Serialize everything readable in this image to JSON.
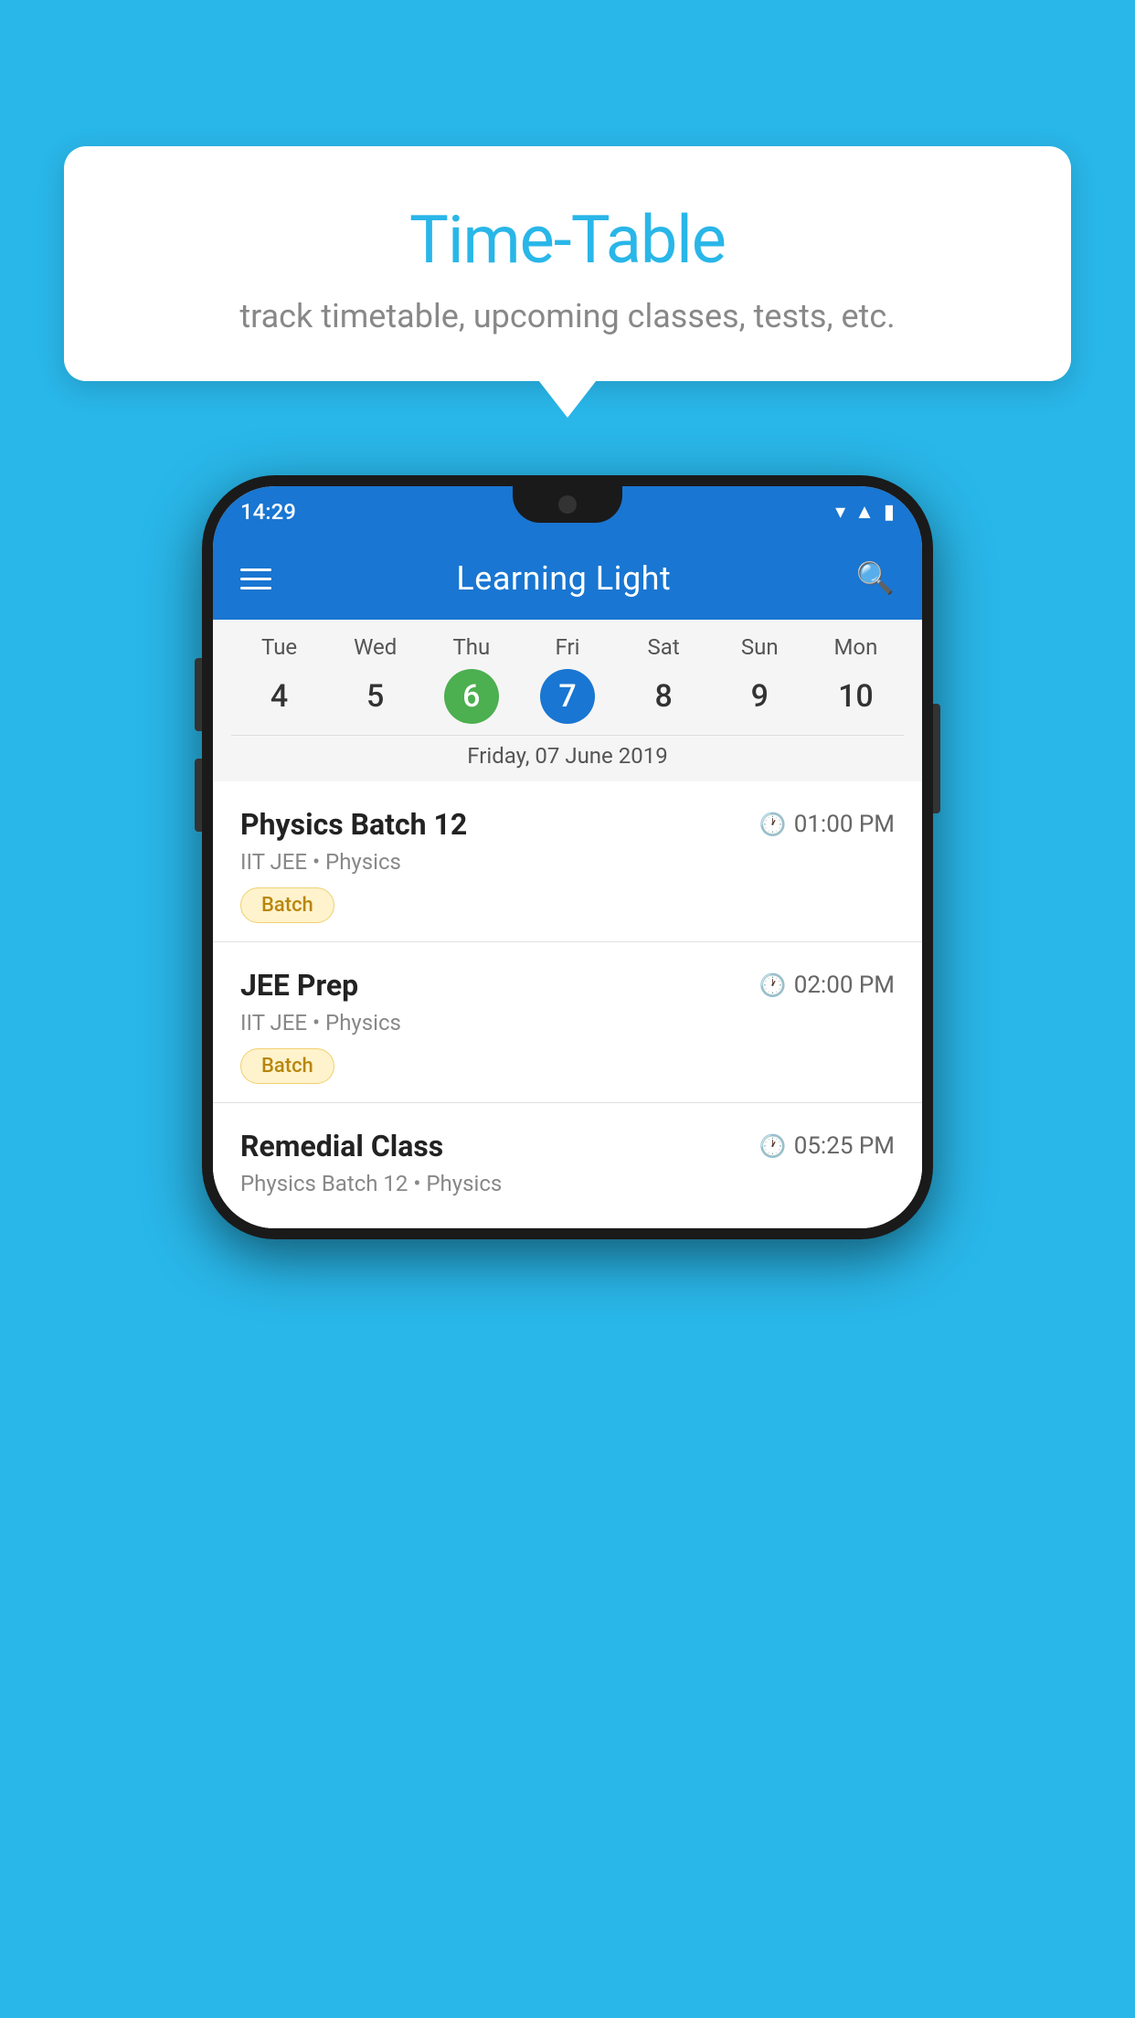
{
  "background_color": "#29b6e8",
  "tooltip": {
    "title": "Time-Table",
    "subtitle": "track timetable, upcoming classes, tests, etc."
  },
  "status_bar": {
    "time": "14:29"
  },
  "app_bar": {
    "title": "Learning Light"
  },
  "calendar": {
    "days": [
      {
        "label": "Tue",
        "num": "4"
      },
      {
        "label": "Wed",
        "num": "5"
      },
      {
        "label": "Thu",
        "num": "6",
        "state": "today"
      },
      {
        "label": "Fri",
        "num": "7",
        "state": "selected"
      },
      {
        "label": "Sat",
        "num": "8"
      },
      {
        "label": "Sun",
        "num": "9"
      },
      {
        "label": "Mon",
        "num": "10"
      }
    ],
    "selected_date_label": "Friday, 07 June 2019"
  },
  "schedule": {
    "items": [
      {
        "title": "Physics Batch 12",
        "time": "01:00 PM",
        "meta": "IIT JEE • Physics",
        "badge": "Batch"
      },
      {
        "title": "JEE Prep",
        "time": "02:00 PM",
        "meta": "IIT JEE • Physics",
        "badge": "Batch"
      },
      {
        "title": "Remedial Class",
        "time": "05:25 PM",
        "meta": "Physics Batch 12 • Physics",
        "badge": null
      }
    ]
  }
}
